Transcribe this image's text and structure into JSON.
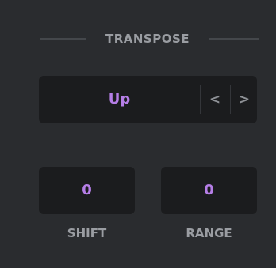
{
  "section": {
    "title": "TRANSPOSE"
  },
  "direction": {
    "value": "Up",
    "prev_icon": "chevron-left-icon",
    "next_icon": "chevron-right-icon",
    "prev_glyph": "<",
    "next_glyph": ">"
  },
  "shift": {
    "value": "0",
    "label": "SHIFT"
  },
  "range": {
    "value": "0",
    "label": "RANGE"
  },
  "colors": {
    "background": "#2a2c2f",
    "field": "#1b1c1e",
    "accent": "#b57ee6",
    "label": "#9a9da2"
  }
}
